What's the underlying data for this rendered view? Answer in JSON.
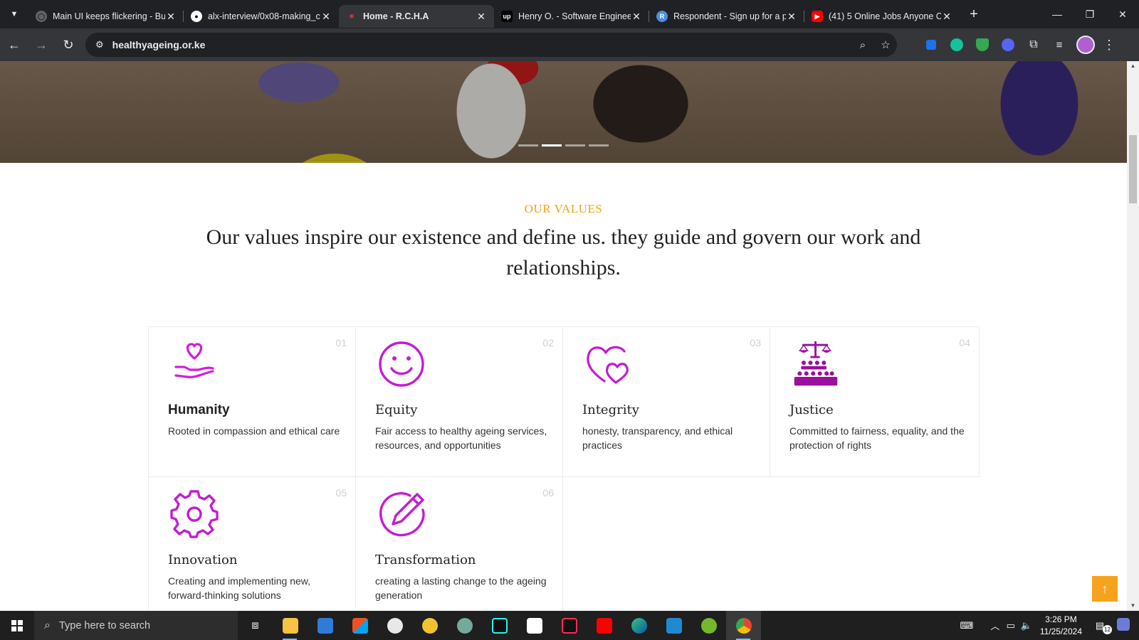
{
  "browser": {
    "tabs": [
      {
        "title": "Main UI keeps flickering - Bu",
        "favicon_color": "#9aa0a6",
        "favicon_icon": "globe-icon"
      },
      {
        "title": "alx-interview/0x08-making_c",
        "favicon_color": "#ffffff",
        "favicon_icon": "github-icon"
      },
      {
        "title": "Home - R.C.H.A",
        "favicon_color": "#35363a",
        "favicon_icon": "site-icon",
        "active": true
      },
      {
        "title": "Henry O. - Software Enginee",
        "favicon_color": "#000000",
        "favicon_icon": "upwork-icon"
      },
      {
        "title": "Respondent - Sign up for a p",
        "favicon_color": "#4a90e2",
        "favicon_icon": "respondent-icon"
      },
      {
        "title": "(41) 5 Online Jobs Anyone C",
        "favicon_color": "#ff0000",
        "favicon_icon": "youtube-icon"
      }
    ],
    "url": "healthyageing.or.ke"
  },
  "page": {
    "slider_dots": [
      false,
      true,
      false,
      false
    ],
    "kicker": "OUR VALUES",
    "heading": "Our values inspire our existence and define us. they guide and govern our work and relationships.",
    "values": [
      {
        "num": "01",
        "name": "Humanity",
        "desc": "Rooted in compassion and ethical care",
        "icon": "heart-hand-icon"
      },
      {
        "num": "02",
        "name": "Equity",
        "desc": "Fair access to healthy ageing services, resources, and opportunities",
        "icon": "smiley-icon"
      },
      {
        "num": "03",
        "name": "Integrity",
        "desc": "honesty, transparency, and ethical practices",
        "icon": "hearts-icon"
      },
      {
        "num": "04",
        "name": "Justice",
        "desc": "Committed to fairness, equality, and the protection of rights",
        "icon": "scales-icon"
      },
      {
        "num": "05",
        "name": "Innovation",
        "desc": "Creating and implementing new, forward-thinking solutions",
        "icon": "gear-icon"
      },
      {
        "num": "06",
        "name": "Transformation",
        "desc": "creating a lasting change to the ageing generation",
        "icon": "pen-circle-icon"
      }
    ],
    "accent_color": "#f0a21a",
    "icon_color": "#c11ecf"
  },
  "taskbar": {
    "search_placeholder": "Type here to search",
    "time": "3:26 PM",
    "date": "11/25/2024",
    "notification_count": "12"
  }
}
